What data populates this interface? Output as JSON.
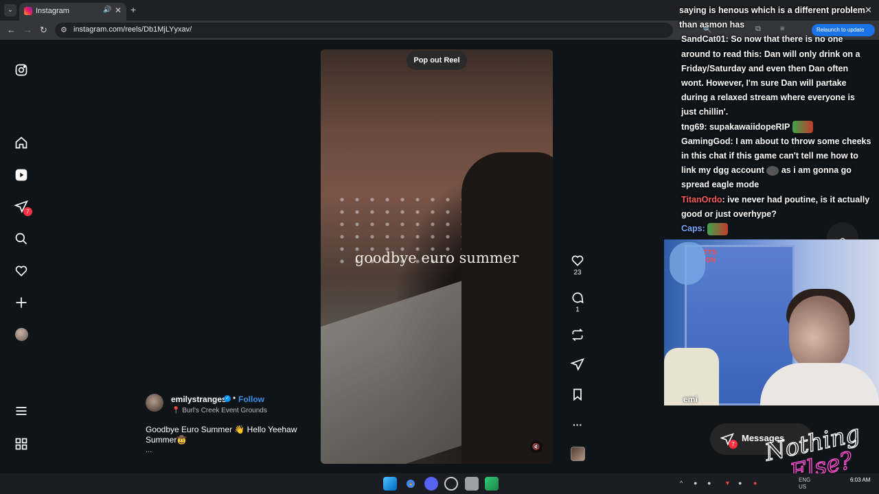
{
  "browser": {
    "tab_title": "Instagram",
    "url": "instagram.com/reels/Db1MjLYyxav/",
    "relaunch_label": "Relaunch to update"
  },
  "nav": {
    "notification_count": "7"
  },
  "reel": {
    "popout_label": "Pop out Reel",
    "overlay_text": "goodbye euro summer",
    "likes": "23",
    "comments": "1"
  },
  "post": {
    "username": "emilystranges",
    "follow_label": "Follow",
    "location": "Burl's Creek Event Grounds",
    "caption": "Goodbye Euro Summer 👋 Hello Yeehaw Summer🤠",
    "more": "..."
  },
  "chat": {
    "messages": [
      {
        "user": "",
        "text": "saying is henous which is a different problem than asmon has"
      },
      {
        "user": "SandCat01:",
        "text": " So now that there is no one around to read this: Dan will only drink on a Friday/Saturday and even then Dan often wont. However, I'm sure Dan will partake during a relaxed stream where everyone is just chillin'."
      },
      {
        "user": "tng69:",
        "text": " supakawaiidopeRIP"
      },
      {
        "user": "GamingGod:",
        "text": " I am about to throw some cheeks in this chat if this game can't tell me how to link my dgg account"
      },
      {
        "user": "",
        "text": "as i am gonna go spread eagle mode"
      },
      {
        "user": "TitanOrdo",
        "text": ": ive never had poutine, is it actually good or just overhype?"
      },
      {
        "user": "Caps:",
        "text": ""
      }
    ]
  },
  "webcam": {
    "tts_label_1": "TTS",
    "tts_label_2": "ON",
    "dog_label": "emi"
  },
  "messages": {
    "label": "Messages",
    "count": "7"
  },
  "overlay_logo": {
    "line1": "Nothing",
    "line2": "Else?"
  },
  "taskbar": {
    "lang_1": "ENG",
    "lang_2": "US",
    "time": "6:03 AM"
  }
}
